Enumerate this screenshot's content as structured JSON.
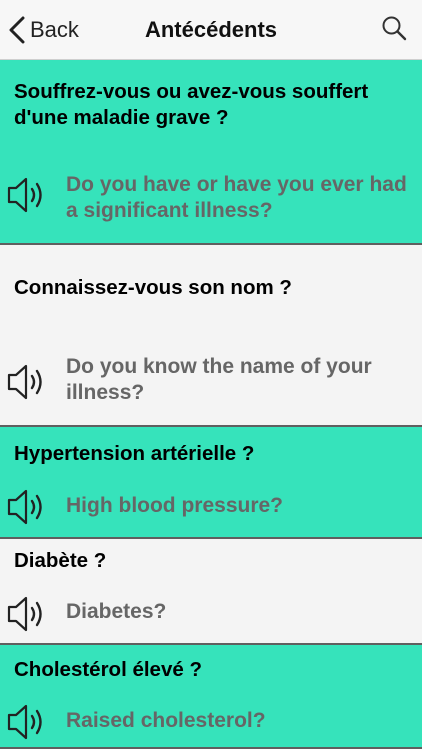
{
  "nav": {
    "back_label": "Back",
    "title": "Antécédents"
  },
  "items": [
    {
      "fr": "Souffrez-vous ou avez-vous souffert d'une maladie grave ?",
      "en": "Do you have or have you ever had a significant illness?",
      "color": "#36e3bb"
    },
    {
      "fr": "Connaissez-vous son nom ?",
      "en": "Do you know the name of your illness?",
      "color": "#f4f4f4"
    },
    {
      "fr": "Hypertension artérielle ?",
      "en": "High blood pressure?",
      "color": "#36e3bb"
    },
    {
      "fr": "Diabète ?",
      "en": "Diabetes?",
      "color": "#f4f4f4"
    },
    {
      "fr": "Cholestérol élevé ?",
      "en": "Raised cholesterol?",
      "color": "#36e3bb"
    }
  ],
  "icons": {
    "back": "chevron-left-icon",
    "search": "search-icon",
    "audio": "speaker-icon"
  }
}
